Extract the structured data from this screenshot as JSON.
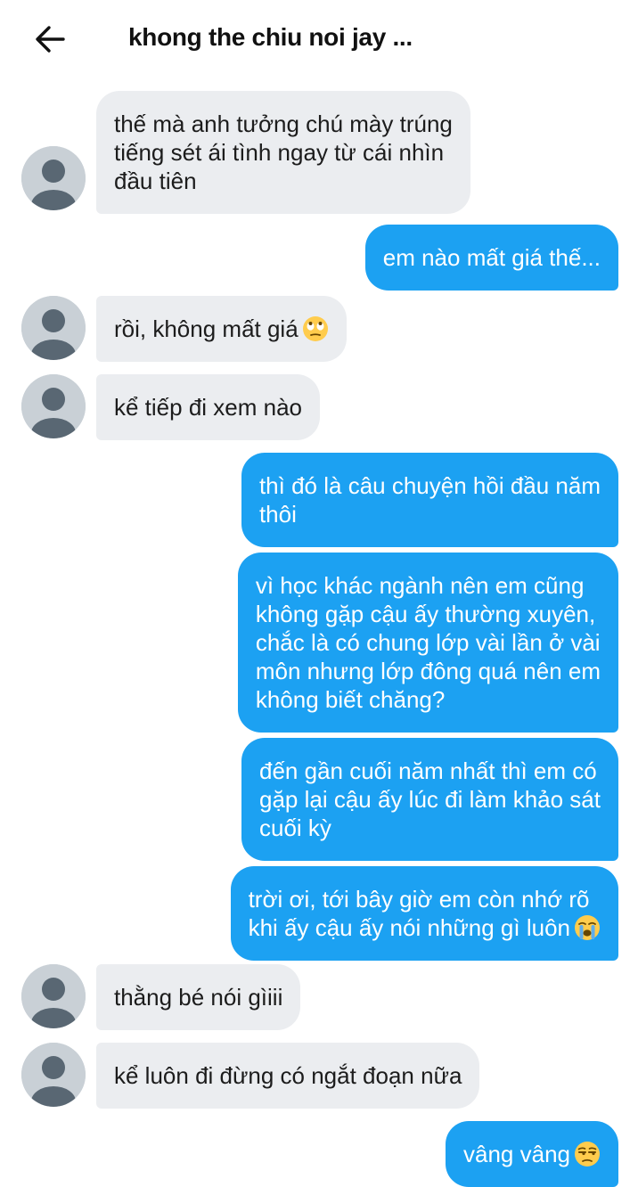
{
  "header": {
    "title": "khong the chiu noi jay ...",
    "back_icon": "arrow-left-icon"
  },
  "colors": {
    "outgoing_bubble": "#1ca1f2",
    "incoming_bubble": "#ebedf0",
    "avatar": "#c9d0d6"
  },
  "messages": [
    {
      "sender": "other",
      "lines": [
        "thế mà anh tưởng chú mày trúng",
        "tiếng sét ái tình ngay từ cái nhìn",
        "đầu tiên"
      ]
    },
    {
      "sender": "me",
      "lines": [
        "em nào mất giá thế..."
      ]
    },
    {
      "sender": "other",
      "lines": [
        "rồi, không mất giá"
      ],
      "emoji": "eye-roll-emoji"
    },
    {
      "sender": "other",
      "lines": [
        "kể tiếp đi xem nào"
      ]
    },
    {
      "sender": "me",
      "lines": [
        "thì đó là câu chuyện hồi đầu năm",
        "thôi"
      ]
    },
    {
      "sender": "me",
      "lines": [
        "vì học khác ngành nên em cũng",
        "không gặp cậu ấy thường xuyên,",
        "chắc là có chung lớp vài lần ở vài",
        "môn nhưng lớp đông quá nên em",
        "không biết chăng?"
      ]
    },
    {
      "sender": "me",
      "lines": [
        "đến gần cuối năm nhất thì em có",
        "gặp lại cậu ấy lúc đi làm khảo sát",
        "cuối kỳ"
      ]
    },
    {
      "sender": "me",
      "lines": [
        "trời ơi, tới bây giờ em còn nhớ rõ",
        "khi ấy cậu ấy nói những gì luôn"
      ],
      "emoji": "crying-emoji"
    },
    {
      "sender": "other",
      "lines": [
        "thằng bé nói gìiii"
      ]
    },
    {
      "sender": "other",
      "lines": [
        "kể luôn đi đừng có ngắt đoạn nữa"
      ]
    },
    {
      "sender": "me",
      "lines": [
        "vâng vâng"
      ],
      "emoji": "unamused-emoji"
    }
  ]
}
